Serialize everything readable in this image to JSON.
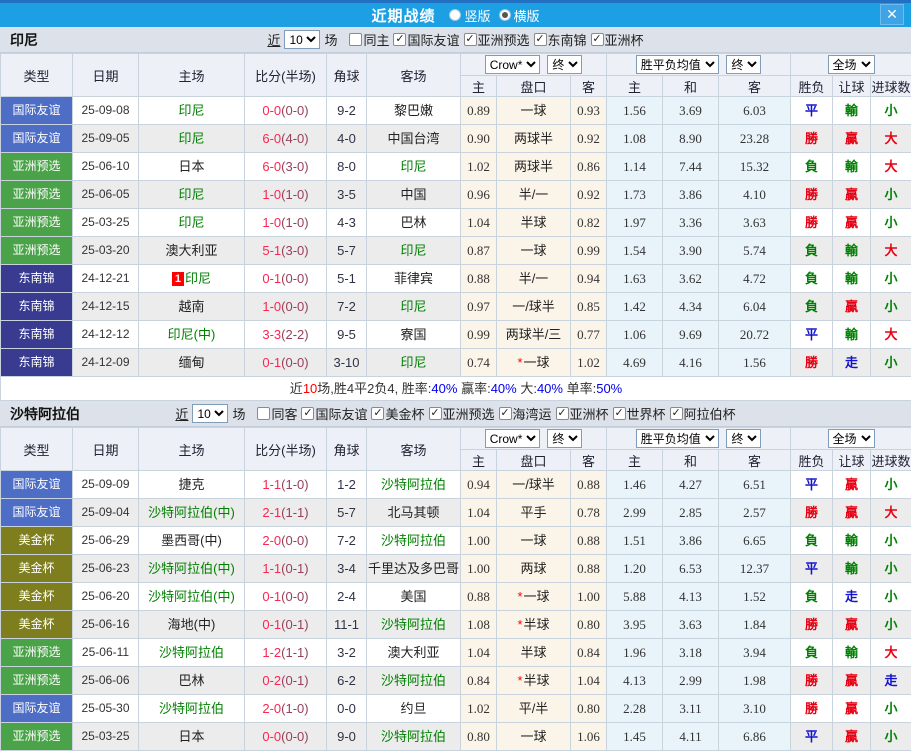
{
  "titlebar": {
    "title": "近期战绩",
    "vertical": "竖版",
    "horizontal": "横版",
    "close": "✕"
  },
  "table_header": {
    "type": "类型",
    "date": "日期",
    "home": "主场",
    "score": "比分(半场)",
    "corner": "角球",
    "away": "客场",
    "odds_home": "主",
    "handicap": "盘口",
    "odds_away": "客",
    "euro_home": "主",
    "euro_draw": "和",
    "euro_away": "客",
    "result": "胜负",
    "give": "让球",
    "goals": "进球数",
    "bookie": "Crow*",
    "final_a": "终",
    "europe_avg": "胜平负均值",
    "final_b": "终",
    "full": "全场"
  },
  "maps": {
    "type_colors": {
      "国际友谊": "#4e6ec6",
      "亚洲预选": "#4aa348",
      "东南锦": "#383b90",
      "美金杯": "#7e7e1e"
    },
    "result_colors": {
      "勝": "#e60012",
      "贏": "#e60012",
      "大": "#e60012",
      "負": "#008000",
      "輸": "#008000",
      "小": "#008000",
      "平": "#1414cc",
      "走": "#1414cc"
    }
  },
  "sections": [
    {
      "team": "印尼",
      "filters": {
        "recent": "近",
        "count": "10",
        "games": "场",
        "same": "同主",
        "leagues": [
          "国际友谊",
          "亚洲预选",
          "东南锦",
          "亚洲杯"
        ]
      },
      "rows": [
        {
          "type": "国际友谊",
          "date": "25-09-08",
          "home": "印尼",
          "hg": true,
          "badge": "",
          "score": "0-0",
          "half": "(0-0)",
          "corner": "9-2",
          "away": "黎巴嫩",
          "ag": false,
          "o1": "0.89",
          "pan": "一球",
          "star": false,
          "o2": "0.93",
          "e1": "1.56",
          "e2": "3.69",
          "e3": "6.03",
          "res": "平",
          "give": "輸",
          "goal": "小"
        },
        {
          "type": "国际友谊",
          "date": "25-09-05",
          "home": "印尼",
          "hg": true,
          "badge": "",
          "score": "6-0",
          "half": "(4-0)",
          "corner": "4-0",
          "away": "中国台湾",
          "ag": false,
          "o1": "0.90",
          "pan": "两球半",
          "star": false,
          "o2": "0.92",
          "e1": "1.08",
          "e2": "8.90",
          "e3": "23.28",
          "res": "勝",
          "give": "贏",
          "goal": "大"
        },
        {
          "type": "亚洲预选",
          "date": "25-06-10",
          "home": "日本",
          "hg": false,
          "badge": "",
          "score": "6-0",
          "half": "(3-0)",
          "corner": "8-0",
          "away": "印尼",
          "ag": true,
          "o1": "1.02",
          "pan": "两球半",
          "star": false,
          "o2": "0.86",
          "e1": "1.14",
          "e2": "7.44",
          "e3": "15.32",
          "res": "負",
          "give": "輸",
          "goal": "大"
        },
        {
          "type": "亚洲预选",
          "date": "25-06-05",
          "home": "印尼",
          "hg": true,
          "badge": "",
          "score": "1-0",
          "half": "(1-0)",
          "corner": "3-5",
          "away": "中国",
          "ag": false,
          "o1": "0.96",
          "pan": "半/一",
          "star": false,
          "o2": "0.92",
          "e1": "1.73",
          "e2": "3.86",
          "e3": "4.10",
          "res": "勝",
          "give": "贏",
          "goal": "小"
        },
        {
          "type": "亚洲预选",
          "date": "25-03-25",
          "home": "印尼",
          "hg": true,
          "badge": "",
          "score": "1-0",
          "half": "(1-0)",
          "corner": "4-3",
          "away": "巴林",
          "ag": false,
          "o1": "1.04",
          "pan": "半球",
          "star": false,
          "o2": "0.82",
          "e1": "1.97",
          "e2": "3.36",
          "e3": "3.63",
          "res": "勝",
          "give": "贏",
          "goal": "小"
        },
        {
          "type": "亚洲预选",
          "date": "25-03-20",
          "home": "澳大利亚",
          "hg": false,
          "badge": "",
          "score": "5-1",
          "half": "(3-0)",
          "corner": "5-7",
          "away": "印尼",
          "ag": true,
          "o1": "0.87",
          "pan": "一球",
          "star": false,
          "o2": "0.99",
          "e1": "1.54",
          "e2": "3.90",
          "e3": "5.74",
          "res": "負",
          "give": "輸",
          "goal": "大"
        },
        {
          "type": "东南锦",
          "date": "24-12-21",
          "home": "印尼",
          "hg": true,
          "badge": "1",
          "score": "0-1",
          "half": "(0-0)",
          "corner": "5-1",
          "away": "菲律宾",
          "ag": false,
          "o1": "0.88",
          "pan": "半/一",
          "star": false,
          "o2": "0.94",
          "e1": "1.63",
          "e2": "3.62",
          "e3": "4.72",
          "res": "負",
          "give": "輸",
          "goal": "小"
        },
        {
          "type": "东南锦",
          "date": "24-12-15",
          "home": "越南",
          "hg": false,
          "badge": "",
          "score": "1-0",
          "half": "(0-0)",
          "corner": "7-2",
          "away": "印尼",
          "ag": true,
          "o1": "0.97",
          "pan": "一/球半",
          "star": false,
          "o2": "0.85",
          "e1": "1.42",
          "e2": "4.34",
          "e3": "6.04",
          "res": "負",
          "give": "贏",
          "goal": "小"
        },
        {
          "type": "东南锦",
          "date": "24-12-12",
          "home": "印尼(中)",
          "hg": true,
          "badge": "",
          "score": "3-3",
          "half": "(2-2)",
          "corner": "9-5",
          "away": "寮国",
          "ag": false,
          "o1": "0.99",
          "pan": "两球半/三",
          "star": false,
          "o2": "0.77",
          "e1": "1.06",
          "e2": "9.69",
          "e3": "20.72",
          "res": "平",
          "give": "輸",
          "goal": "大"
        },
        {
          "type": "东南锦",
          "date": "24-12-09",
          "home": "缅甸",
          "hg": false,
          "badge": "",
          "score": "0-1",
          "half": "(0-0)",
          "corner": "3-10",
          "away": "印尼",
          "ag": true,
          "o1": "0.74",
          "pan": "一球",
          "star": true,
          "o2": "1.02",
          "e1": "4.69",
          "e2": "4.16",
          "e3": "1.56",
          "res": "勝",
          "give": "走",
          "goal": "小"
        }
      ],
      "summary": [
        {
          "t": "近",
          "c": "#333333"
        },
        {
          "t": "10",
          "c": "#ff0000"
        },
        {
          "t": "场,胜4平2负4, 胜率:",
          "c": "#333333"
        },
        {
          "t": "40%",
          "c": "#0000ee"
        },
        {
          "t": " 赢率:",
          "c": "#333333"
        },
        {
          "t": "40%",
          "c": "#0000ee"
        },
        {
          "t": " 大:",
          "c": "#333333"
        },
        {
          "t": "40%",
          "c": "#0000ee"
        },
        {
          "t": " 单率:",
          "c": "#333333"
        },
        {
          "t": "50%",
          "c": "#0000ee"
        }
      ]
    },
    {
      "team": "沙特阿拉伯",
      "filters": {
        "recent": "近",
        "count": "10",
        "games": "场",
        "same": "同客",
        "leagues": [
          "国际友谊",
          "美金杯",
          "亚洲预选",
          "海湾运",
          "亚洲杯",
          "世界杯",
          "阿拉伯杯"
        ]
      },
      "rows": [
        {
          "type": "国际友谊",
          "date": "25-09-09",
          "home": "捷克",
          "hg": false,
          "badge": "",
          "score": "1-1",
          "half": "(1-0)",
          "corner": "1-2",
          "away": "沙特阿拉伯",
          "ag": true,
          "o1": "0.94",
          "pan": "一/球半",
          "star": false,
          "o2": "0.88",
          "e1": "1.46",
          "e2": "4.27",
          "e3": "6.51",
          "res": "平",
          "give": "贏",
          "goal": "小"
        },
        {
          "type": "国际友谊",
          "date": "25-09-04",
          "home": "沙特阿拉伯(中)",
          "hg": true,
          "badge": "",
          "score": "2-1",
          "half": "(1-1)",
          "corner": "5-7",
          "away": "北马其顿",
          "ag": false,
          "o1": "1.04",
          "pan": "平手",
          "star": false,
          "o2": "0.78",
          "e1": "2.99",
          "e2": "2.85",
          "e3": "2.57",
          "res": "勝",
          "give": "贏",
          "goal": "大"
        },
        {
          "type": "美金杯",
          "date": "25-06-29",
          "home": "墨西哥(中)",
          "hg": false,
          "badge": "",
          "score": "2-0",
          "half": "(0-0)",
          "corner": "7-2",
          "away": "沙特阿拉伯",
          "ag": true,
          "o1": "1.00",
          "pan": "一球",
          "star": false,
          "o2": "0.88",
          "e1": "1.51",
          "e2": "3.86",
          "e3": "6.65",
          "res": "負",
          "give": "輸",
          "goal": "小"
        },
        {
          "type": "美金杯",
          "date": "25-06-23",
          "home": "沙特阿拉伯(中)",
          "hg": true,
          "badge": "",
          "score": "1-1",
          "half": "(0-1)",
          "corner": "3-4",
          "away": "千里达及多巴哥",
          "ag": false,
          "o1": "1.00",
          "pan": "两球",
          "star": false,
          "o2": "0.88",
          "e1": "1.20",
          "e2": "6.53",
          "e3": "12.37",
          "res": "平",
          "give": "輸",
          "goal": "小"
        },
        {
          "type": "美金杯",
          "date": "25-06-20",
          "home": "沙特阿拉伯(中)",
          "hg": true,
          "badge": "",
          "score": "0-1",
          "half": "(0-0)",
          "corner": "2-4",
          "away": "美国",
          "ag": false,
          "o1": "0.88",
          "pan": "一球",
          "star": true,
          "o2": "1.00",
          "e1": "5.88",
          "e2": "4.13",
          "e3": "1.52",
          "res": "負",
          "give": "走",
          "goal": "小"
        },
        {
          "type": "美金杯",
          "date": "25-06-16",
          "home": "海地(中)",
          "hg": false,
          "badge": "",
          "score": "0-1",
          "half": "(0-1)",
          "corner": "11-1",
          "away": "沙特阿拉伯",
          "ag": true,
          "o1": "1.08",
          "pan": "半球",
          "star": true,
          "o2": "0.80",
          "e1": "3.95",
          "e2": "3.63",
          "e3": "1.84",
          "res": "勝",
          "give": "贏",
          "goal": "小"
        },
        {
          "type": "亚洲预选",
          "date": "25-06-11",
          "home": "沙特阿拉伯",
          "hg": true,
          "badge": "",
          "score": "1-2",
          "half": "(1-1)",
          "corner": "3-2",
          "away": "澳大利亚",
          "ag": false,
          "o1": "1.04",
          "pan": "半球",
          "star": false,
          "o2": "0.84",
          "e1": "1.96",
          "e2": "3.18",
          "e3": "3.94",
          "res": "負",
          "give": "輸",
          "goal": "大"
        },
        {
          "type": "亚洲预选",
          "date": "25-06-06",
          "home": "巴林",
          "hg": false,
          "badge": "",
          "score": "0-2",
          "half": "(0-1)",
          "corner": "6-2",
          "away": "沙特阿拉伯",
          "ag": true,
          "o1": "0.84",
          "pan": "半球",
          "star": true,
          "o2": "1.04",
          "e1": "4.13",
          "e2": "2.99",
          "e3": "1.98",
          "res": "勝",
          "give": "贏",
          "goal": "走"
        },
        {
          "type": "国际友谊",
          "date": "25-05-30",
          "home": "沙特阿拉伯",
          "hg": true,
          "badge": "",
          "score": "2-0",
          "half": "(1-0)",
          "corner": "0-0",
          "away": "约旦",
          "ag": false,
          "o1": "1.02",
          "pan": "平/半",
          "star": false,
          "o2": "0.80",
          "e1": "2.28",
          "e2": "3.11",
          "e3": "3.10",
          "res": "勝",
          "give": "贏",
          "goal": "小"
        },
        {
          "type": "亚洲预选",
          "date": "25-03-25",
          "home": "日本",
          "hg": false,
          "badge": "",
          "score": "0-0",
          "half": "(0-0)",
          "corner": "9-0",
          "away": "沙特阿拉伯",
          "ag": true,
          "o1": "0.80",
          "pan": "一球",
          "star": false,
          "o2": "1.06",
          "e1": "1.45",
          "e2": "4.11",
          "e3": "6.86",
          "res": "平",
          "give": "贏",
          "goal": "小"
        }
      ]
    }
  ]
}
